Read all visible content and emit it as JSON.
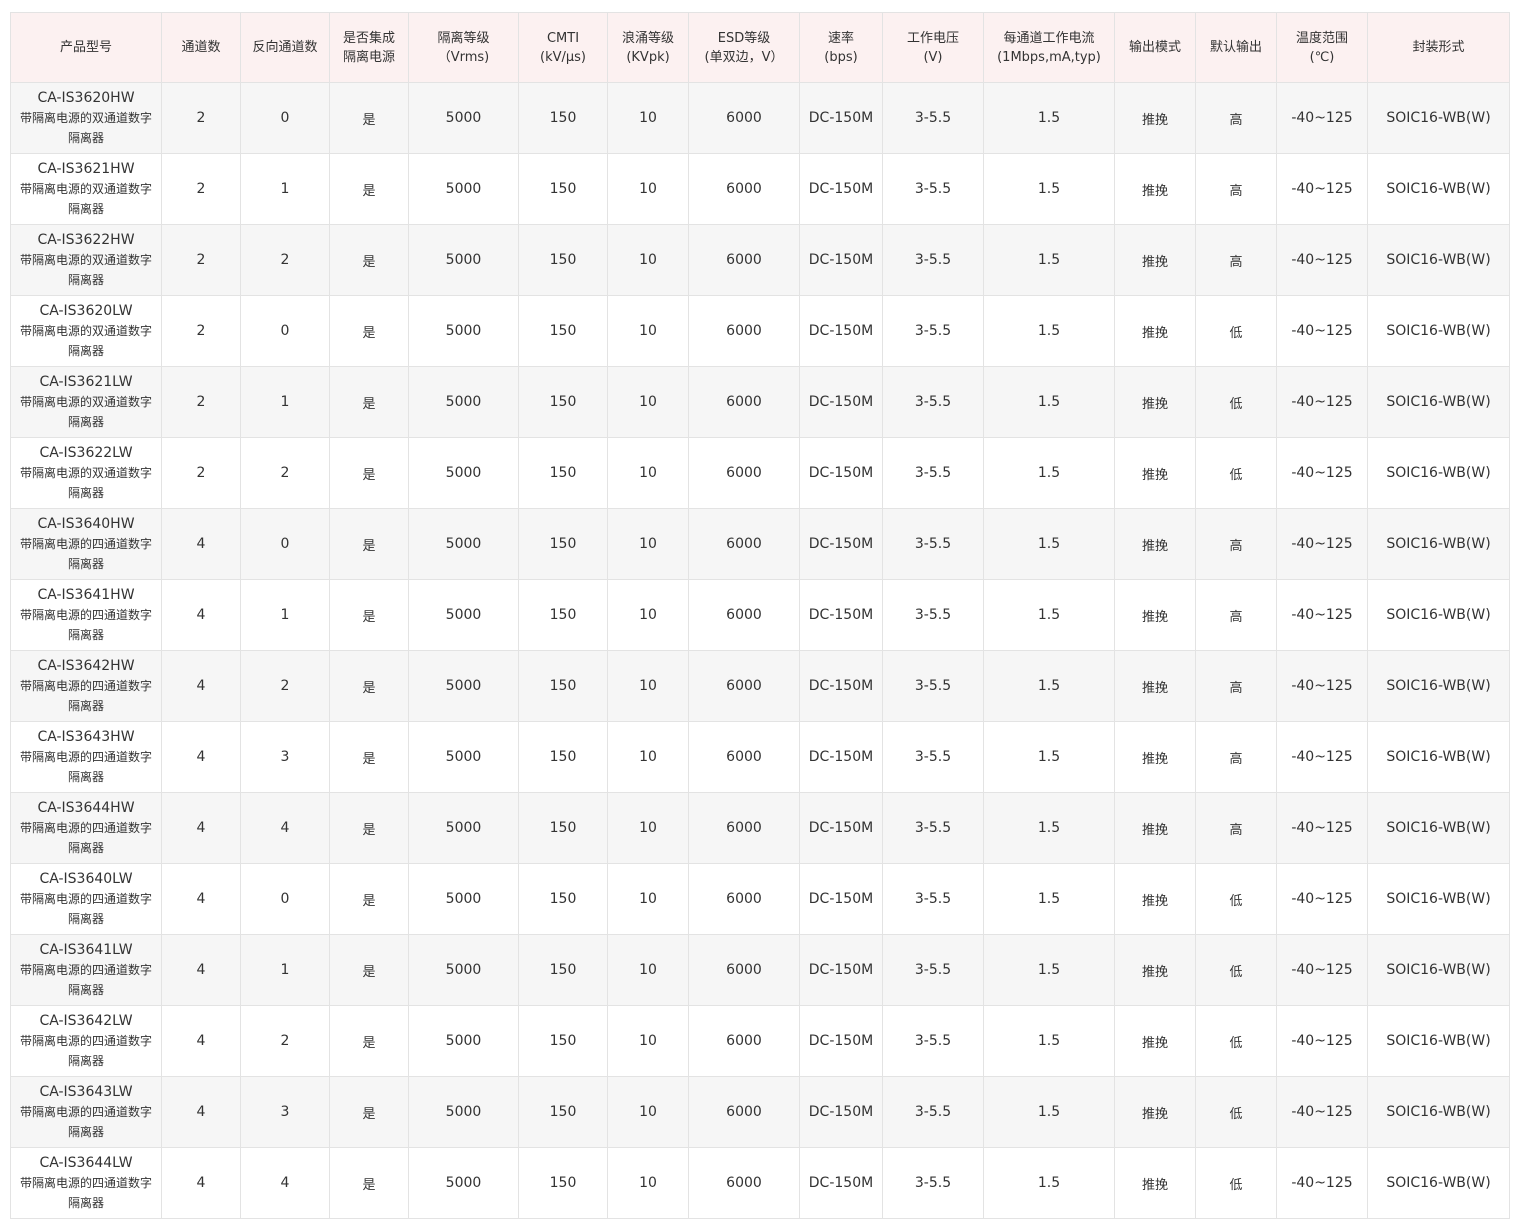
{
  "headers": [
    [
      "产品型号"
    ],
    [
      "通道数"
    ],
    [
      "反向通道数"
    ],
    [
      "是否集成",
      "隔离电源"
    ],
    [
      "隔离等级",
      "（Vrms)"
    ],
    [
      "CMTI",
      "(kV/μs)"
    ],
    [
      "浪涌等级",
      "(KVpk)"
    ],
    [
      "ESD等级",
      "(单双边，V）"
    ],
    [
      "速率",
      "(bps)"
    ],
    [
      "工作电压",
      "(V)"
    ],
    [
      "每通道工作电流",
      "(1Mbps,mA,typ)"
    ],
    [
      "输出模式"
    ],
    [
      "默认输出"
    ],
    [
      "温度范围",
      "(℃)"
    ],
    [
      "封装形式"
    ]
  ],
  "rows": [
    {
      "model": "CA-IS3620HW",
      "desc": "带隔离电源的双通道数字隔离器",
      "channels": "2",
      "reverse": "0",
      "integrated": "是",
      "isolation": "5000",
      "cmti": "150",
      "surge": "10",
      "esd": "6000",
      "rate": "DC-150M",
      "voltage": "3-5.5",
      "current": "1.5",
      "output_mode": "推挽",
      "default_output": "高",
      "temp": "-40~125",
      "package": "SOIC16-WB(W)"
    },
    {
      "model": "CA-IS3621HW",
      "desc": "带隔离电源的双通道数字隔离器",
      "channels": "2",
      "reverse": "1",
      "integrated": "是",
      "isolation": "5000",
      "cmti": "150",
      "surge": "10",
      "esd": "6000",
      "rate": "DC-150M",
      "voltage": "3-5.5",
      "current": "1.5",
      "output_mode": "推挽",
      "default_output": "高",
      "temp": "-40~125",
      "package": "SOIC16-WB(W)"
    },
    {
      "model": "CA-IS3622HW",
      "desc": "带隔离电源的双通道数字隔离器",
      "channels": "2",
      "reverse": "2",
      "integrated": "是",
      "isolation": "5000",
      "cmti": "150",
      "surge": "10",
      "esd": "6000",
      "rate": "DC-150M",
      "voltage": "3-5.5",
      "current": "1.5",
      "output_mode": "推挽",
      "default_output": "高",
      "temp": "-40~125",
      "package": "SOIC16-WB(W)"
    },
    {
      "model": "CA-IS3620LW",
      "desc": "带隔离电源的双通道数字隔离器",
      "channels": "2",
      "reverse": "0",
      "integrated": "是",
      "isolation": "5000",
      "cmti": "150",
      "surge": "10",
      "esd": "6000",
      "rate": "DC-150M",
      "voltage": "3-5.5",
      "current": "1.5",
      "output_mode": "推挽",
      "default_output": "低",
      "temp": "-40~125",
      "package": "SOIC16-WB(W)"
    },
    {
      "model": "CA-IS3621LW",
      "desc": "带隔离电源的双通道数字隔离器",
      "channels": "2",
      "reverse": "1",
      "integrated": "是",
      "isolation": "5000",
      "cmti": "150",
      "surge": "10",
      "esd": "6000",
      "rate": "DC-150M",
      "voltage": "3-5.5",
      "current": "1.5",
      "output_mode": "推挽",
      "default_output": "低",
      "temp": "-40~125",
      "package": "SOIC16-WB(W)"
    },
    {
      "model": "CA-IS3622LW",
      "desc": "带隔离电源的双通道数字隔离器",
      "channels": "2",
      "reverse": "2",
      "integrated": "是",
      "isolation": "5000",
      "cmti": "150",
      "surge": "10",
      "esd": "6000",
      "rate": "DC-150M",
      "voltage": "3-5.5",
      "current": "1.5",
      "output_mode": "推挽",
      "default_output": "低",
      "temp": "-40~125",
      "package": "SOIC16-WB(W)"
    },
    {
      "model": "CA-IS3640HW",
      "desc": "带隔离电源的四通道数字隔离器",
      "channels": "4",
      "reverse": "0",
      "integrated": "是",
      "isolation": "5000",
      "cmti": "150",
      "surge": "10",
      "esd": "6000",
      "rate": "DC-150M",
      "voltage": "3-5.5",
      "current": "1.5",
      "output_mode": "推挽",
      "default_output": "高",
      "temp": "-40~125",
      "package": "SOIC16-WB(W)"
    },
    {
      "model": "CA-IS3641HW",
      "desc": "带隔离电源的四通道数字隔离器",
      "channels": "4",
      "reverse": "1",
      "integrated": "是",
      "isolation": "5000",
      "cmti": "150",
      "surge": "10",
      "esd": "6000",
      "rate": "DC-150M",
      "voltage": "3-5.5",
      "current": "1.5",
      "output_mode": "推挽",
      "default_output": "高",
      "temp": "-40~125",
      "package": "SOIC16-WB(W)"
    },
    {
      "model": "CA-IS3642HW",
      "desc": "带隔离电源的四通道数字隔离器",
      "channels": "4",
      "reverse": "2",
      "integrated": "是",
      "isolation": "5000",
      "cmti": "150",
      "surge": "10",
      "esd": "6000",
      "rate": "DC-150M",
      "voltage": "3-5.5",
      "current": "1.5",
      "output_mode": "推挽",
      "default_output": "高",
      "temp": "-40~125",
      "package": "SOIC16-WB(W)"
    },
    {
      "model": "CA-IS3643HW",
      "desc": "带隔离电源的四通道数字隔离器",
      "channels": "4",
      "reverse": "3",
      "integrated": "是",
      "isolation": "5000",
      "cmti": "150",
      "surge": "10",
      "esd": "6000",
      "rate": "DC-150M",
      "voltage": "3-5.5",
      "current": "1.5",
      "output_mode": "推挽",
      "default_output": "高",
      "temp": "-40~125",
      "package": "SOIC16-WB(W)"
    },
    {
      "model": "CA-IS3644HW",
      "desc": "带隔离电源的四通道数字隔离器",
      "channels": "4",
      "reverse": "4",
      "integrated": "是",
      "isolation": "5000",
      "cmti": "150",
      "surge": "10",
      "esd": "6000",
      "rate": "DC-150M",
      "voltage": "3-5.5",
      "current": "1.5",
      "output_mode": "推挽",
      "default_output": "高",
      "temp": "-40~125",
      "package": "SOIC16-WB(W)"
    },
    {
      "model": "CA-IS3640LW",
      "desc": "带隔离电源的四通道数字隔离器",
      "channels": "4",
      "reverse": "0",
      "integrated": "是",
      "isolation": "5000",
      "cmti": "150",
      "surge": "10",
      "esd": "6000",
      "rate": "DC-150M",
      "voltage": "3-5.5",
      "current": "1.5",
      "output_mode": "推挽",
      "default_output": "低",
      "temp": "-40~125",
      "package": "SOIC16-WB(W)"
    },
    {
      "model": "CA-IS3641LW",
      "desc": "带隔离电源的四通道数字隔离器",
      "channels": "4",
      "reverse": "1",
      "integrated": "是",
      "isolation": "5000",
      "cmti": "150",
      "surge": "10",
      "esd": "6000",
      "rate": "DC-150M",
      "voltage": "3-5.5",
      "current": "1.5",
      "output_mode": "推挽",
      "default_output": "低",
      "temp": "-40~125",
      "package": "SOIC16-WB(W)"
    },
    {
      "model": "CA-IS3642LW",
      "desc": "带隔离电源的四通道数字隔离器",
      "channels": "4",
      "reverse": "2",
      "integrated": "是",
      "isolation": "5000",
      "cmti": "150",
      "surge": "10",
      "esd": "6000",
      "rate": "DC-150M",
      "voltage": "3-5.5",
      "current": "1.5",
      "output_mode": "推挽",
      "default_output": "低",
      "temp": "-40~125",
      "package": "SOIC16-WB(W)"
    },
    {
      "model": "CA-IS3643LW",
      "desc": "带隔离电源的四通道数字隔离器",
      "channels": "4",
      "reverse": "3",
      "integrated": "是",
      "isolation": "5000",
      "cmti": "150",
      "surge": "10",
      "esd": "6000",
      "rate": "DC-150M",
      "voltage": "3-5.5",
      "current": "1.5",
      "output_mode": "推挽",
      "default_output": "低",
      "temp": "-40~125",
      "package": "SOIC16-WB(W)"
    },
    {
      "model": "CA-IS3644LW",
      "desc": "带隔离电源的四通道数字隔离器",
      "channels": "4",
      "reverse": "4",
      "integrated": "是",
      "isolation": "5000",
      "cmti": "150",
      "surge": "10",
      "esd": "6000",
      "rate": "DC-150M",
      "voltage": "3-5.5",
      "current": "1.5",
      "output_mode": "推挽",
      "default_output": "低",
      "temp": "-40~125",
      "package": "SOIC16-WB(W)"
    }
  ],
  "colors": {
    "header_bg": "#fcf1f1",
    "row_alt_bg": "#f6f6f6",
    "border": "#e3e3e3",
    "text": "#333333"
  }
}
